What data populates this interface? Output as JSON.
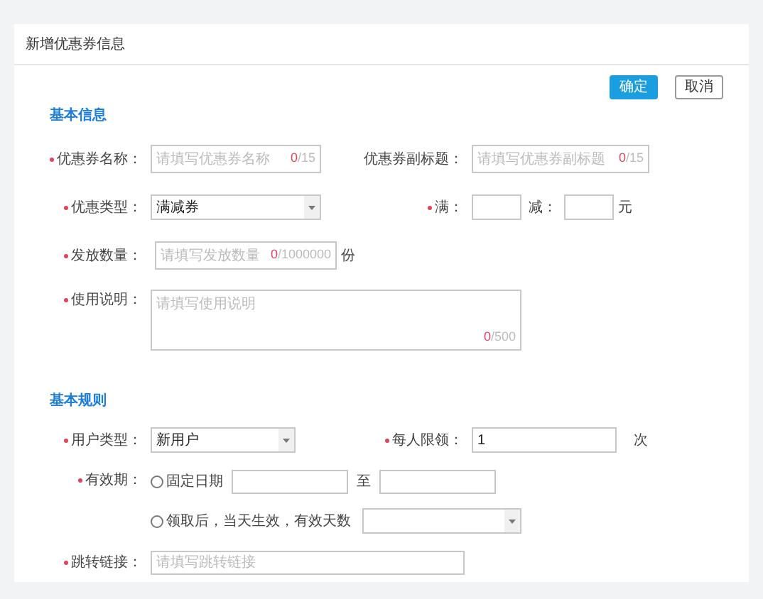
{
  "title": "新增优惠券信息",
  "buttons": [
    {
      "label": "确定",
      "kind": "primary"
    },
    {
      "label": "取消",
      "kind": "default"
    }
  ],
  "basic_info": {
    "heading": "基本信息",
    "coupon_name": {
      "label": "优惠券名称：",
      "required": true,
      "placeholder": "请填写优惠券名称",
      "count": "0",
      "max": "/15"
    },
    "coupon_subtitle": {
      "label": "优惠券副标题：",
      "required": false,
      "placeholder": "请填写优惠券副标题",
      "count": "0",
      "max": "/15"
    },
    "coupon_type": {
      "label": "优惠类型：",
      "required": true,
      "value": "满减券"
    },
    "threshold": {
      "label": "满：",
      "required": true
    },
    "discount": {
      "label": "减：",
      "unit": "元"
    },
    "quantity": {
      "label": "发放数量：",
      "required": true,
      "placeholder": "请填写发放数量",
      "count": "0",
      "max": "/1000000",
      "unit": "份"
    },
    "usage_notes": {
      "label": "使用说明：",
      "required": true,
      "placeholder": "请填写使用说明",
      "count": "0",
      "max": "/500"
    }
  },
  "basic_rules": {
    "heading": "基本规则",
    "user_type": {
      "label": "用户类型：",
      "required": true,
      "value": "新用户"
    },
    "per_person_limit": {
      "label": "每人限领：",
      "required": true,
      "value": "1",
      "unit": "次"
    },
    "validity": {
      "label": "有效期：",
      "required": true,
      "options": [
        {
          "label": "固定日期",
          "selected": false,
          "kind": "date_range",
          "separator": "至"
        },
        {
          "label": "领取后，当天生效，有效天数",
          "selected": false,
          "kind": "days_select"
        }
      ]
    },
    "redirect_link": {
      "label": "跳转链接：",
      "required": true,
      "placeholder": "请填写跳转链接"
    }
  }
}
